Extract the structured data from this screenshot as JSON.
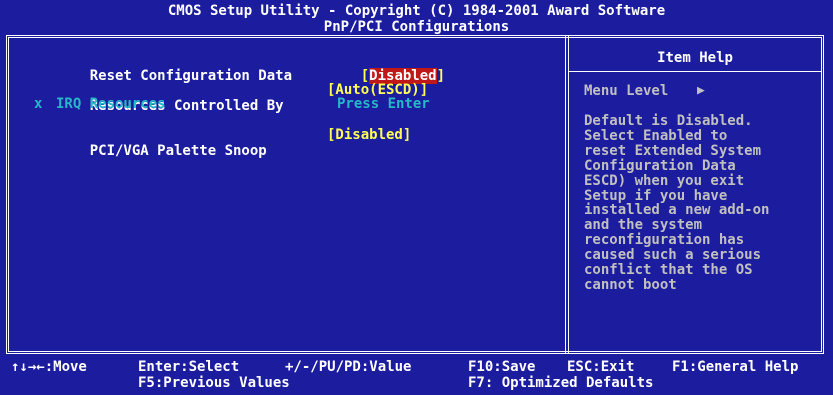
{
  "title": {
    "line1": "CMOS Setup Utility - Copyright (C) 1984-2001 Award Software",
    "line2": "PnP/PCI Configurations"
  },
  "settings": [
    {
      "label": "Reset Configuration Data",
      "bracket_open": "[",
      "value": "Disabled",
      "bracket_close": "]",
      "selected": true
    },
    {
      "label": "Resources Controlled By",
      "value_text": "[Auto(ESCD)]"
    },
    {
      "prefix": "x",
      "label": "IRQ Resources",
      "value_text": "Press Enter",
      "disabled": true
    },
    {
      "label": "PCI/VGA Palette Snoop",
      "value_text": "[Disabled]"
    }
  ],
  "help": {
    "title": "Item Help",
    "menu_level": "Menu Level",
    "menu_level_icon": "right-triangle-icon",
    "text": "Default is Disabled.\nSelect Enabled to\nreset Extended System\nConfiguration Data\nESCD) when you exit\nSetup if you have\ninstalled a new add-on\nand the system\nreconfiguration has\ncaused such a serious\nconflict that the OS\ncannot boot"
  },
  "footer": {
    "move": "↑↓→←:Move",
    "select": "Enter:Select",
    "value": "+/-/PU/PD:Value",
    "save": "F10:Save",
    "exit": "ESC:Exit",
    "general_help": "F1:General Help",
    "previous": "F5:Previous Values",
    "defaults": "F7: Optimized Defaults"
  },
  "colors": {
    "background": "#1c1c9e",
    "label": "#ffffff",
    "value": "#ffff55",
    "disabled": "#26b8c8",
    "highlight": "#c01818",
    "help_text": "#c0c0c0"
  }
}
